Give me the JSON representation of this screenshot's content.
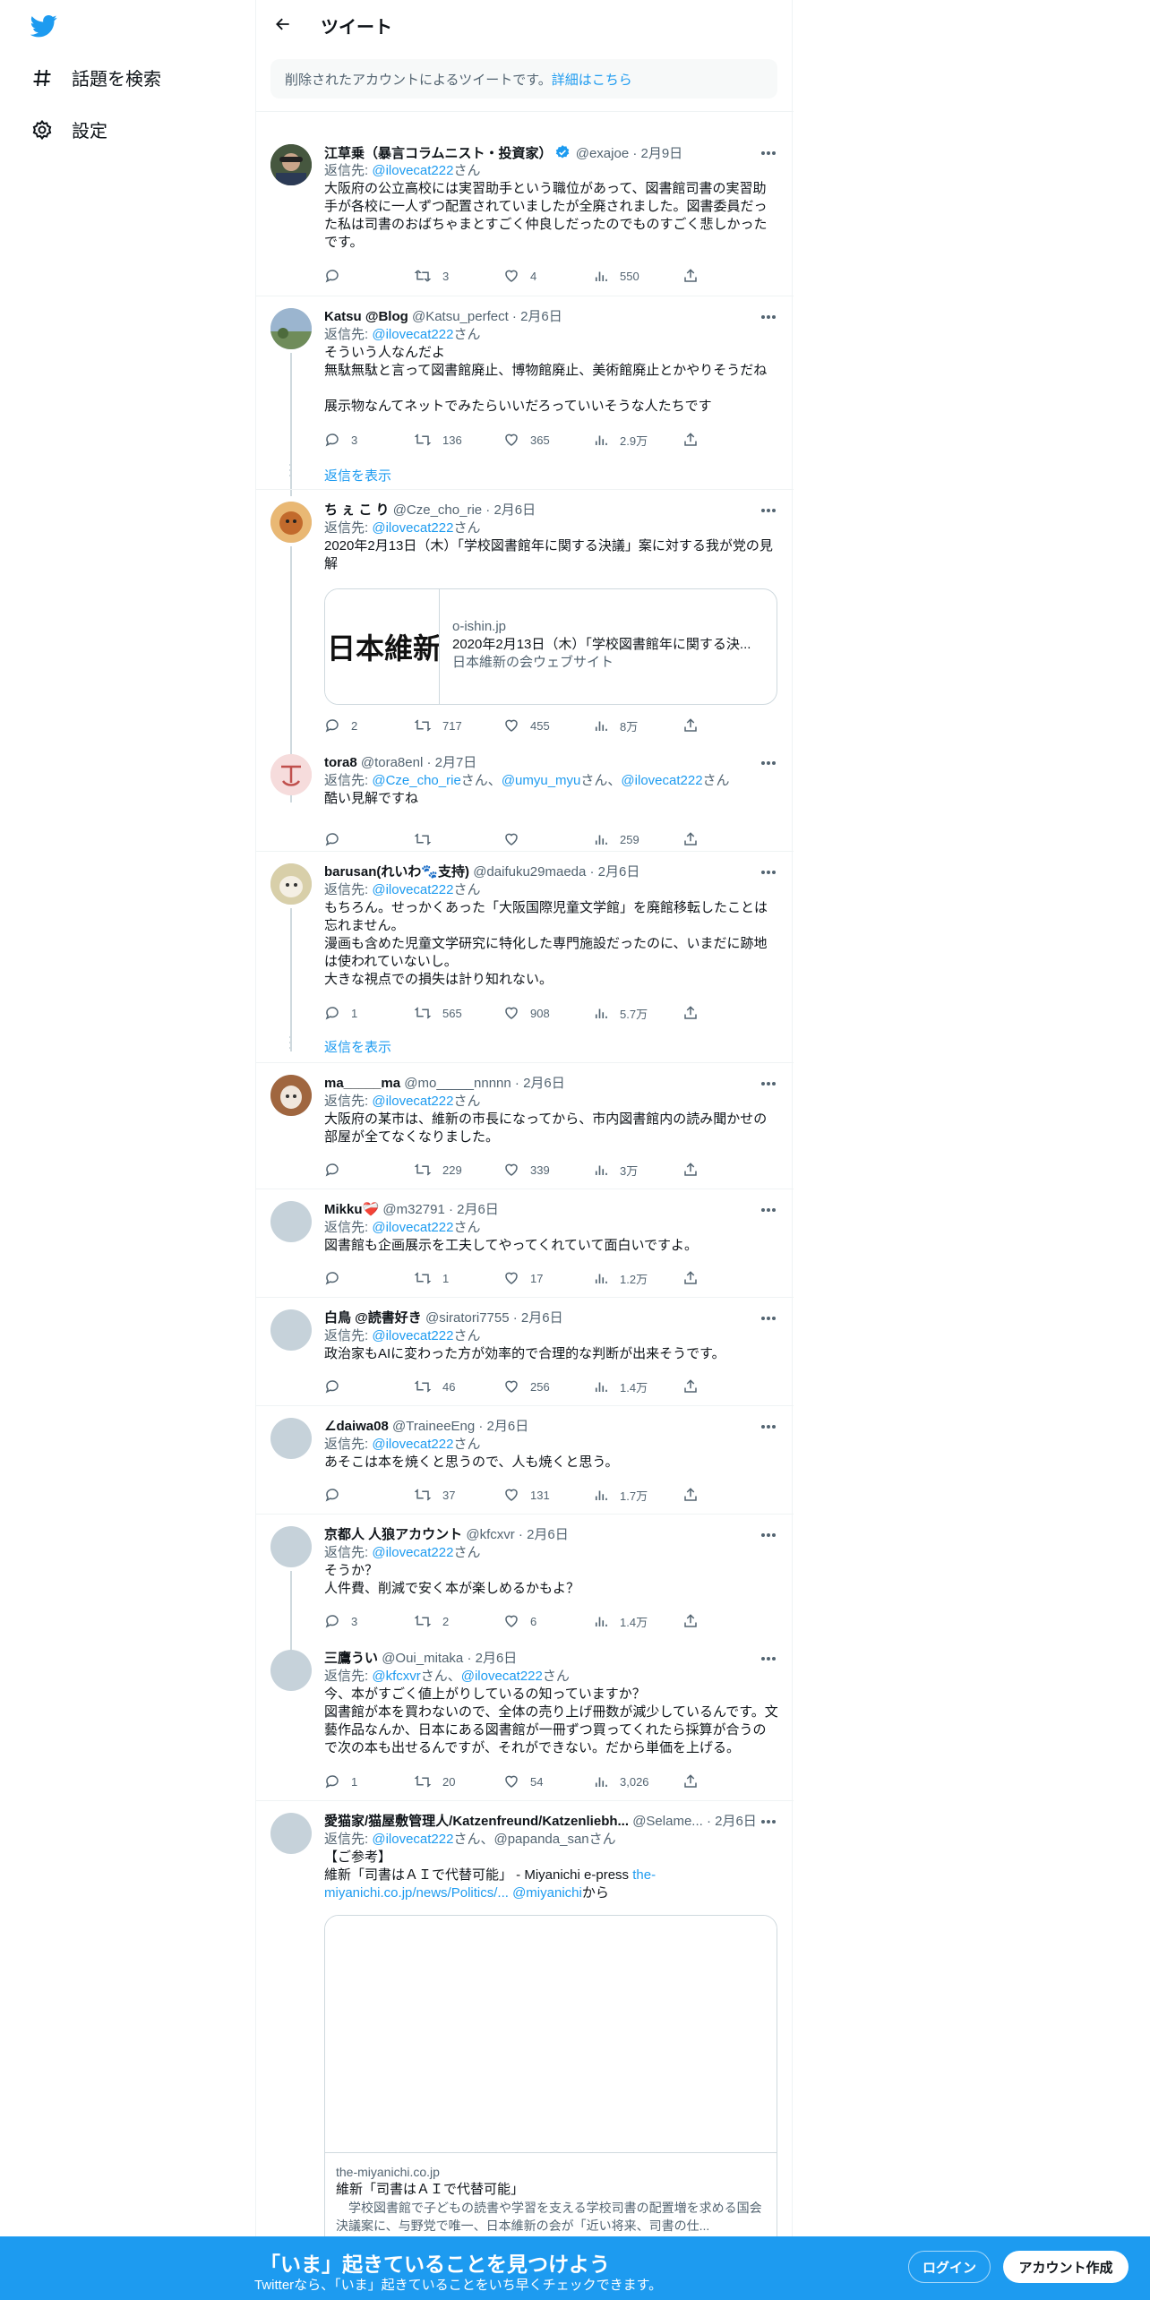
{
  "nav": {
    "explore_label": "話題を検索",
    "settings_label": "設定"
  },
  "header": {
    "title": "ツイート"
  },
  "deleted_notice": {
    "text": "削除されたアカウントによるツイートです。",
    "link": "詳細はこちら"
  },
  "reply_to_label": "返信先: ",
  "san": "さん",
  "show_replies_label": "返信を表示",
  "tweets": [
    {
      "name": "江草乗（暴言コラムニスト・投資家）",
      "handle": "@exajoe · 2月9日",
      "reply_to": "@ilovecat222",
      "text": "大阪府の公立高校には実習助手という職位があって、図書館司書の実習助手が各校に一人ずつ配置されていましたが全廃されました。図書委員だった私は司書のおばちゃまとすごく仲良しだったのでものすごく悲しかったです。",
      "replies": "",
      "retweets": "3",
      "likes": "4",
      "views": "550"
    },
    {
      "name": "Katsu @Blog",
      "handle": "@Katsu_perfect · 2月6日",
      "reply_to": "@ilovecat222",
      "text": "そういう人なんだよ\n無駄無駄と言って図書館廃止、博物館廃止、美術館廃止とかやりそうだね\n\n展示物なんてネットでみたらいいだろっていいそうな人たちです",
      "replies": "3",
      "retweets": "136",
      "likes": "365",
      "views": "2.9万"
    },
    {
      "name": "ち ぇ こ り",
      "handle": "@Cze_cho_rie · 2月6日",
      "reply_to": "@ilovecat222",
      "text": "2020年2月13日（木）「学校図書館年に関する決議」案に対する我が党の見解",
      "card": {
        "domain": "o-ishin.jp",
        "title": "2020年2月13日（木）「学校図書館年に関する決...",
        "description": "日本維新の会ウェブサイト",
        "image_text": "日本維新"
      },
      "replies": "2",
      "retweets": "717",
      "likes": "455",
      "views": "8万"
    },
    {
      "name": "tora8",
      "handle": "@tora8enl · 2月7日",
      "reply_to_multi": [
        "@Cze_cho_rie",
        "さん、",
        "@umyu_myu",
        "さん、",
        "@ilovecat222",
        "さん"
      ],
      "text": "酷い見解ですね",
      "replies": "",
      "retweets": "",
      "likes": "",
      "views": "259"
    },
    {
      "name": "barusan(れいわ🐾支持)",
      "handle": "@daifuku29maeda · 2月6日",
      "reply_to": "@ilovecat222",
      "text": "もちろん。せっかくあった「大阪国際児童文学館」を廃館移転したことは忘れません。\n漫画も含めた児童文学研究に特化した専門施設だったのに、いまだに跡地は使われていないし。\n大きな視点での損失は計り知れない。",
      "replies": "1",
      "retweets": "565",
      "likes": "908",
      "views": "5.7万"
    },
    {
      "name": "ma_____ma",
      "handle": "@mo_____nnnnn · 2月6日",
      "reply_to": "@ilovecat222",
      "text": "大阪府の某市は、維新の市長になってから、市内図書館内の読み聞かせの部屋が全てなくなりました。",
      "replies": "",
      "retweets": "229",
      "likes": "339",
      "views": "3万"
    },
    {
      "name": "Mikku❤️‍🩹",
      "handle": "@m32791 · 2月6日",
      "reply_to": "@ilovecat222",
      "text": "図書館も企画展示を工夫してやってくれていて面白いですよ。",
      "replies": "",
      "retweets": "1",
      "likes": "17",
      "views": "1.2万"
    },
    {
      "name": "白鳥 @読書好き",
      "handle": "@siratori7755 · 2月6日",
      "reply_to": "@ilovecat222",
      "text": "政治家もAIに変わった方が効率的で合理的な判断が出来そうです。",
      "replies": "",
      "retweets": "46",
      "likes": "256",
      "views": "1.4万"
    },
    {
      "name": "∠daiwa08",
      "handle": "@TraineeEng · 2月6日",
      "reply_to": "@ilovecat222",
      "text": "あそこは本を焼くと思うので、人も焼くと思う。",
      "replies": "",
      "retweets": "37",
      "likes": "131",
      "views": "1.7万"
    },
    {
      "name": "京都人 人狼アカウント",
      "handle": "@kfcxvr · 2月6日",
      "reply_to": "@ilovecat222",
      "text": "そうか？\n人件費、削減で安く本が楽しめるかもよ？",
      "replies": "3",
      "retweets": "2",
      "likes": "6",
      "views": "1.4万"
    },
    {
      "name": "三鷹うい",
      "handle": "@Oui_mitaka · 2月6日",
      "reply_to_multi": [
        "@kfcxvr",
        "さん、",
        "@ilovecat222",
        "さん"
      ],
      "text": "今、本がすごく値上がりしているの知っていますか？\n図書館が本を買わないので、全体の売り上げ冊数が減少しているんです。文藝作品なんか、日本にある図書館が一冊ずつ買ってくれたら採算が合うので次の本も出せるんですが、それができない。だから単価を上げる。",
      "replies": "1",
      "retweets": "20",
      "likes": "54",
      "views": "3,026"
    },
    {
      "name": "愛猫家/猫屋敷管理人/Katzenfreund/Katzenliebh...",
      "handle": "@Selame... · 2月6日",
      "reply_to_multi": [
        "@ilovecat222",
        "さん、",
        "@papanda_san",
        "さん"
      ],
      "text_line1": "【ご参考】",
      "text_line2": "維新「司書はＡＩで代替可能」 - Miyanichi e-press ",
      "link1": "the-miyanichi.co.jp/news/Politics/...",
      "link2": "@miyanichi",
      "from": "から",
      "card": {
        "domain": "the-miyanichi.co.jp",
        "title": "維新「司書はＡＩで代替可能」",
        "description": "　学校図書館で子どもの読書や学習を支える学校司書の配置増を求める国会決議案に、与野党で唯一、日本維新の会が「近い将来、司書の仕..."
      }
    }
  ],
  "bottom_bar": {
    "title": "「いま」起きていることを見つけよう",
    "subtitle": "Twitterなら、「いま」起きていることをいち早くチェックできます。",
    "login": "ログイン",
    "signup": "アカウント作成"
  },
  "colors": {
    "accent": "#1d9bf0",
    "secondary_text": "#536471",
    "bottom_bar": "#1d9bf0"
  }
}
